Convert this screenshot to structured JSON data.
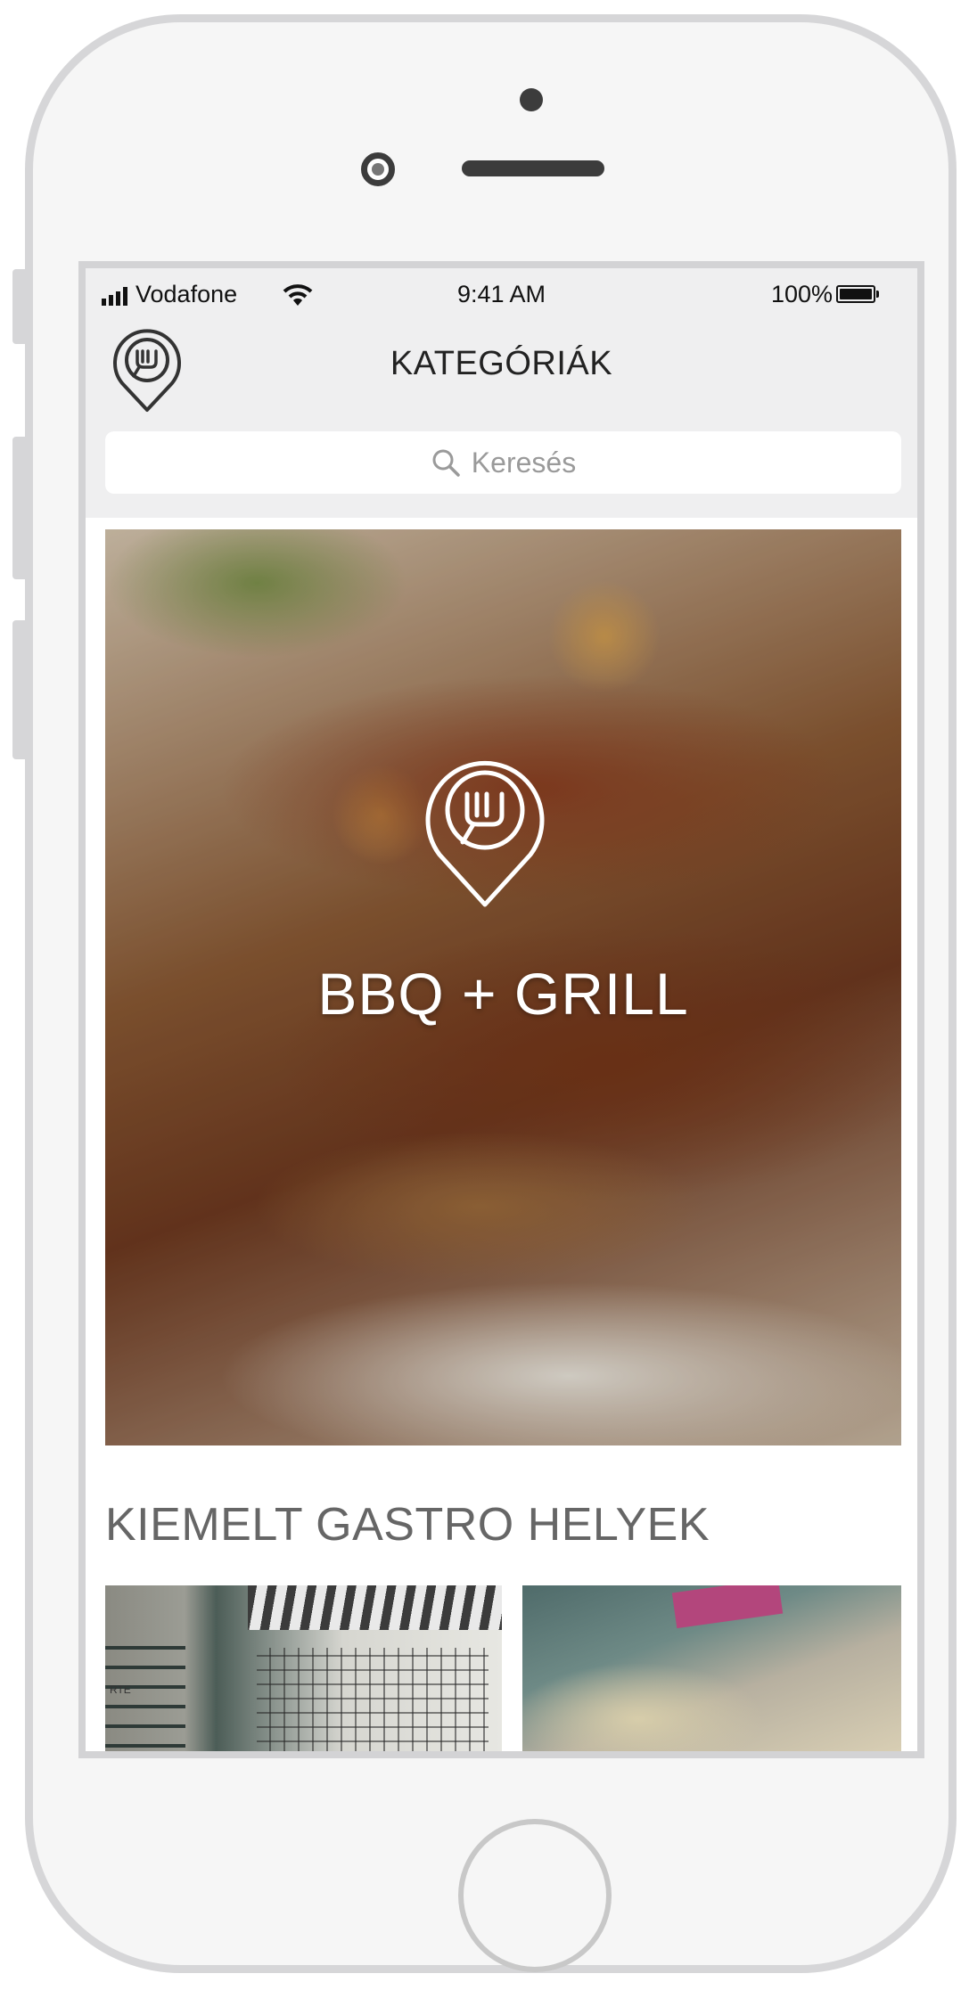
{
  "status_bar": {
    "carrier": "Vodafone",
    "time": "9:41 AM",
    "battery_percent": "100%"
  },
  "header": {
    "title": "KATEGÓRIÁK"
  },
  "search": {
    "placeholder": "Keresés"
  },
  "hero": {
    "category": "BBQ + GRILL"
  },
  "featured": {
    "title": "KIEMELT GASTRO HELYEK",
    "cards": [
      {
        "sign_text": "RTE"
      },
      {}
    ]
  },
  "colors": {
    "frame": "#d6d6d8",
    "topbar": "#efeff0",
    "section_title": "#666666",
    "text_dark": "#222222"
  }
}
